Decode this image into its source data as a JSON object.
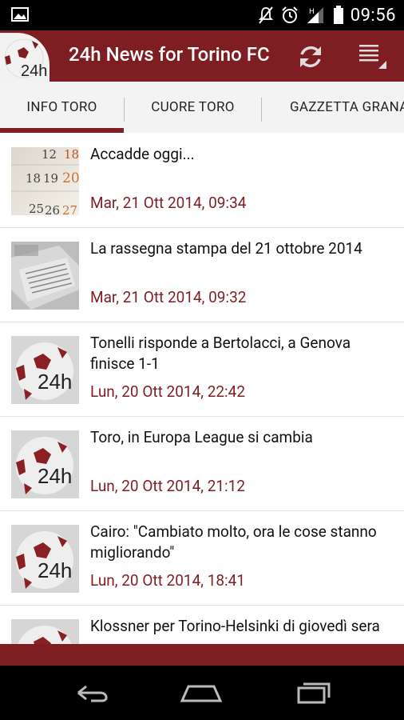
{
  "status_bar": {
    "time": "09:56",
    "icons": [
      "image-icon",
      "mute-icon",
      "alarm-icon",
      "signal-icon",
      "battery-icon"
    ]
  },
  "action_bar": {
    "logo_text": "24h",
    "title": "24h News for Torino FC",
    "accent_color": "#7f1e22"
  },
  "tabs": [
    {
      "label": "INFO TORO",
      "selected": true
    },
    {
      "label": "CUORE TORO",
      "selected": false
    },
    {
      "label": "GAZZETTA GRANATA",
      "selected": false
    }
  ],
  "news": [
    {
      "title": "Accadde oggi...",
      "date": "Mar, 21 Ott 2014, 09:34",
      "thumb": "calendar"
    },
    {
      "title": "La rassegna stampa del 21 ottobre 2014",
      "date": "Mar, 21 Ott 2014, 09:32",
      "thumb": "newspaper"
    },
    {
      "title": "Tonelli risponde a Bertolacci, a Genova finisce 1-1",
      "date": "Lun, 20 Ott 2014, 22:42",
      "thumb": "logo"
    },
    {
      "title": "Toro, in Europa League si cambia",
      "date": "Lun, 20 Ott 2014, 21:12",
      "thumb": "logo"
    },
    {
      "title": "Cairo: \"Cambiato molto, ora le cose stanno migliorando\"",
      "date": "Lun, 20 Ott 2014, 18:41",
      "thumb": "logo"
    },
    {
      "title": "Klossner per Torino-Helsinki di giovedì sera",
      "date": "",
      "thumb": "logo"
    }
  ],
  "calendar_thumb_numbers": [
    "12",
    "18",
    "19",
    "20",
    "25",
    "26",
    "27"
  ],
  "thumb_logo_text": "24h"
}
